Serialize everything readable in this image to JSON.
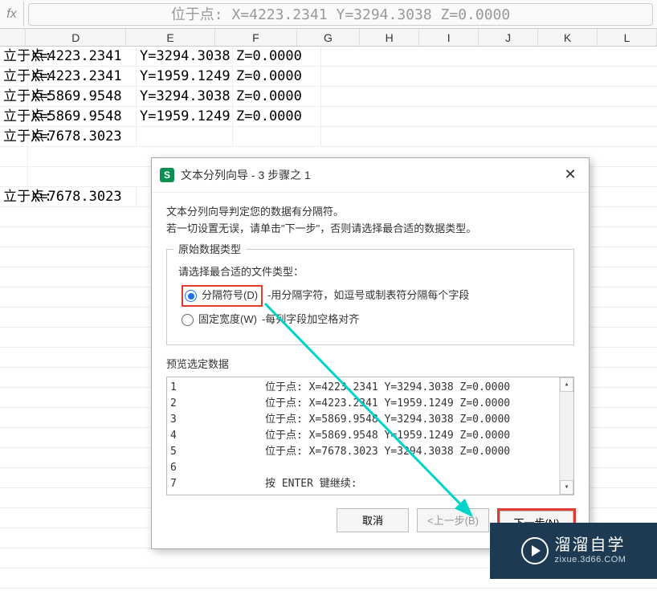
{
  "formula_bar": {
    "label": "fx",
    "value": "位于点: X=4223.2341  Y=3294.3038  Z=0.0000"
  },
  "columns": [
    "D",
    "E",
    "F",
    "G",
    "H",
    "I",
    "J",
    "K",
    "L"
  ],
  "rows": [
    {
      "c": "立于点:",
      "d": "X=4223.2341",
      "e": "Y=3294.3038",
      "f": "Z=0.0000"
    },
    {
      "c": "立于点:",
      "d": "X=4223.2341",
      "e": "Y=1959.1249",
      "f": "Z=0.0000"
    },
    {
      "c": "立于点:",
      "d": "X=5869.9548",
      "e": "Y=3294.3038",
      "f": "Z=0.0000"
    },
    {
      "c": "立于点:",
      "d": "X=5869.9548",
      "e": "Y=1959.1249",
      "f": "Z=0.0000"
    },
    {
      "c": "立于点:",
      "d": "X=7678.3023",
      "e": "",
      "f": ""
    },
    {
      "c": "",
      "d": "",
      "e": "",
      "f": ""
    },
    {
      "c": "",
      "d": "",
      "e": "",
      "f": ""
    },
    {
      "c": "立于点:",
      "d": "X=7678.3023",
      "e": "",
      "f": ""
    }
  ],
  "dialog": {
    "title": "文本分列向导 - 3 步骤之 1",
    "desc1": "文本分列向导判定您的数据有分隔符。",
    "desc2": "若一切设置无误，请单击\"下一步\"，否则请选择最合适的数据类型。",
    "fieldset_legend": "原始数据类型",
    "prompt": "请选择最合适的文件类型：",
    "opt_delim_label": "分隔符号(D)",
    "opt_delim_desc": "-用分隔字符，如逗号或制表符分隔每个字段",
    "opt_fixed_label": "固定宽度(W)",
    "opt_fixed_desc": "-每列字段加空格对齐",
    "preview_label": "预览选定数据",
    "preview_rows": [
      {
        "n": "1",
        "t": "位于点: X=4223.2341  Y=3294.3038  Z=0.0000"
      },
      {
        "n": "2",
        "t": "位于点: X=4223.2341  Y=1959.1249  Z=0.0000"
      },
      {
        "n": "3",
        "t": "位于点: X=5869.9548  Y=3294.3038  Z=0.0000"
      },
      {
        "n": "4",
        "t": "位于点: X=5869.9548  Y=1959.1249  Z=0.0000"
      },
      {
        "n": "5",
        "t": "位于点: X=7678.3023  Y=3294.3038  Z=0.0000"
      },
      {
        "n": "6",
        "t": ""
      },
      {
        "n": "7",
        "t": "按 ENTER 键继续:"
      }
    ],
    "btn_cancel": "取消",
    "btn_back": "<上一步(B)",
    "btn_next": "下一步(N)"
  },
  "watermark": {
    "big": "溜溜自学",
    "small": "zixue.3d66.COM"
  }
}
